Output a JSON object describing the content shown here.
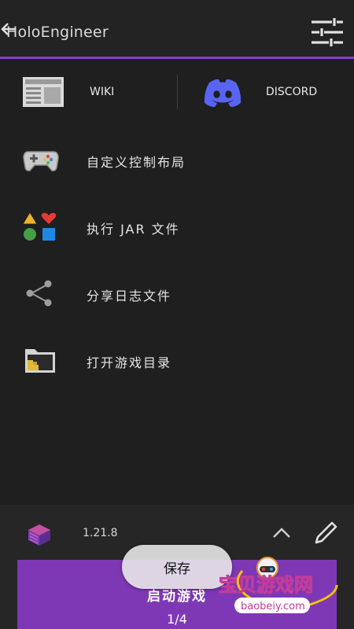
{
  "header": {
    "title": "HoloEngineer",
    "back_icon": "back-arrow-icon",
    "settings_icon": "sliders-icon"
  },
  "links": {
    "wiki_label": "WIKI",
    "discord_label": "DISCORD"
  },
  "menu": {
    "items": [
      {
        "label": "自定义控制布局",
        "icon": "gamepad-icon"
      },
      {
        "label": "执行 JAR 文件",
        "icon": "shapes-icon"
      },
      {
        "label": "分享日志文件",
        "icon": "share-icon"
      },
      {
        "label": "打开游戏目录",
        "icon": "folder-icon"
      }
    ]
  },
  "footer": {
    "version": "1.21.8",
    "launch_label": "启动游戏",
    "page_indicator": "1/4"
  },
  "toast": {
    "text": "保存"
  },
  "watermark": {
    "title": "宝贝游戏网",
    "url": "baobeiy.com"
  },
  "colors": {
    "accent": "#8a3fc4",
    "launch_button": "#7e38b5",
    "discord": "#5865f2",
    "background": "#1f1f1f"
  }
}
